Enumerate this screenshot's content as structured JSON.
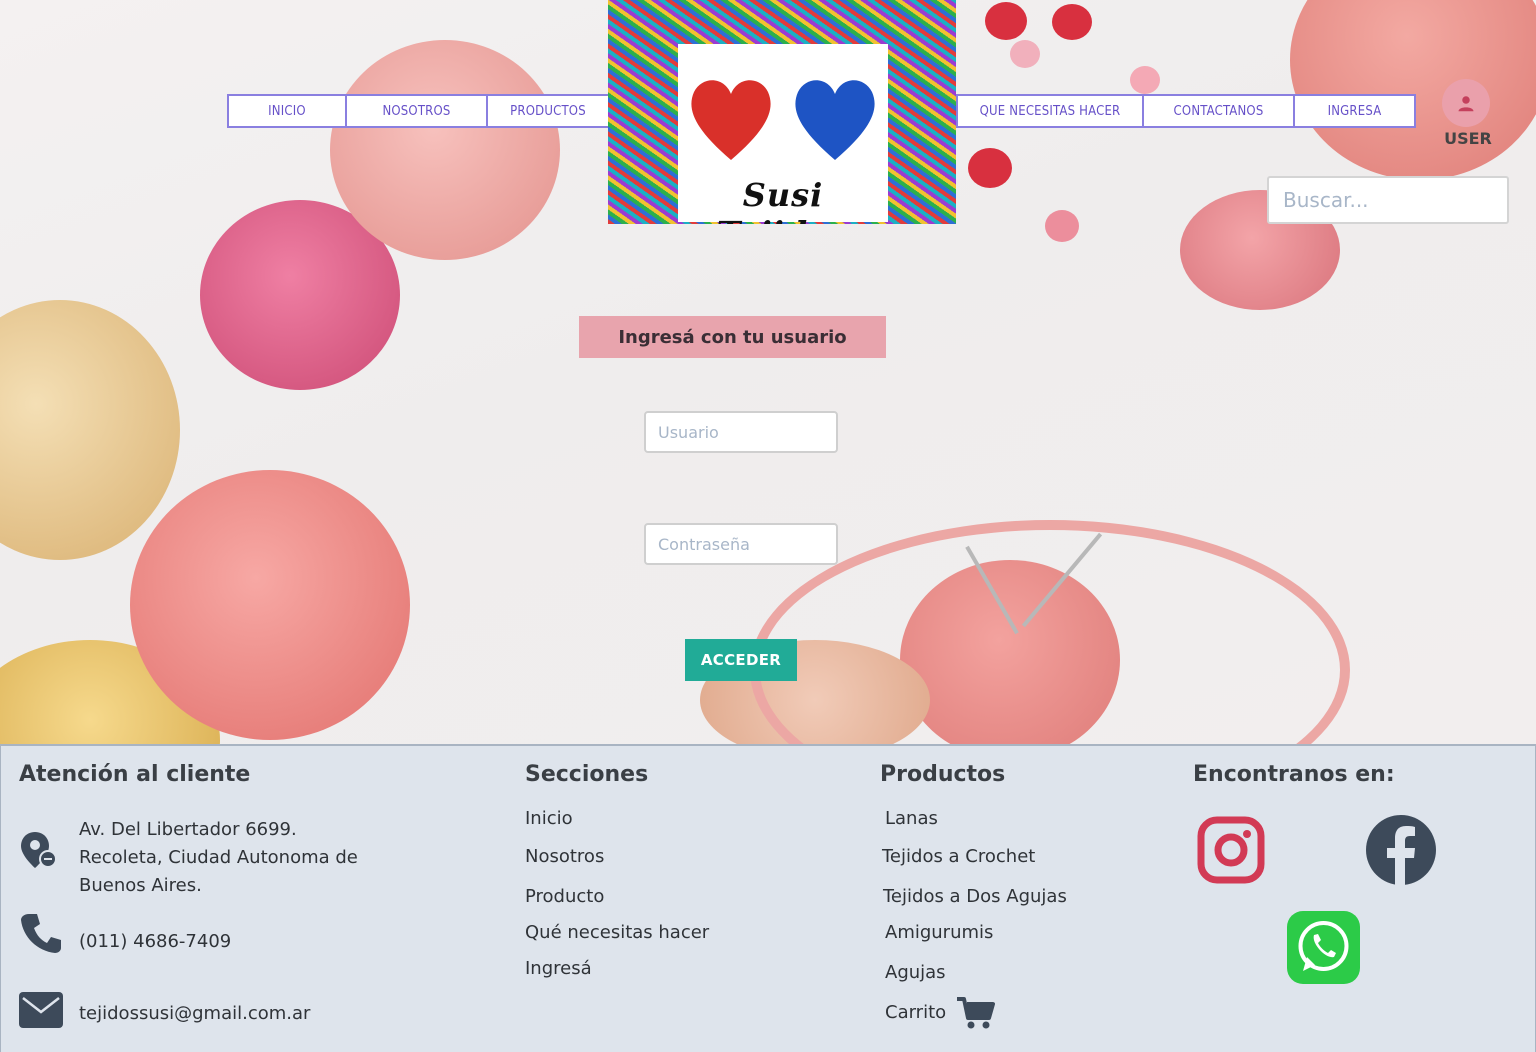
{
  "nav": {
    "left": [
      "INICIO",
      "NOSOTROS",
      "PRODUCTOS"
    ],
    "right": [
      "QUE NECESITAS HACER",
      "CONTACTANOS",
      "INGRESA"
    ]
  },
  "logo": {
    "title": "Susi Tejidos"
  },
  "user": {
    "label": "USER"
  },
  "search": {
    "placeholder": "Buscar..."
  },
  "login": {
    "title": "Ingresá con tu usuario",
    "user_placeholder": "Usuario",
    "password_placeholder": "Contraseña",
    "submit_label": "ACCEDER"
  },
  "footer": {
    "contact": {
      "heading": "Atención al cliente",
      "address": [
        "Av. Del Libertador 6699.",
        "Recoleta, Ciudad Autonoma de",
        "Buenos Aires."
      ],
      "phone": "(011) 4686-7409",
      "email": "tejidossusi@gmail.com.ar"
    },
    "sections": {
      "heading": "Secciones",
      "items": [
        "Inicio",
        "Nosotros",
        "Producto",
        "Qué necesitas hacer",
        "Ingresá"
      ]
    },
    "products": {
      "heading": "Productos",
      "items": [
        "Lanas",
        "Tejidos a Crochet",
        "Tejidos a Dos Agujas",
        "Amigurumis",
        "Agujas",
        "Carrito"
      ]
    },
    "social": {
      "heading": "Encontranos en:"
    }
  },
  "colors": {
    "nav_border": "#8a7fe0",
    "login_title_bg": "#e8a4ad",
    "accent_button": "#21ab97",
    "footer_bg": "#dee4ec"
  }
}
